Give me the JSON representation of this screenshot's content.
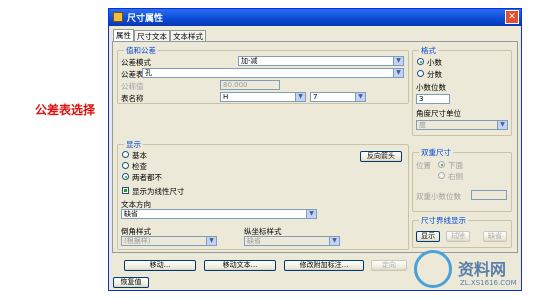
{
  "annotation": {
    "label": "公差表选择"
  },
  "window": {
    "title": "尺寸属性",
    "close_glyph": "✕"
  },
  "tabs": [
    {
      "label": "属性",
      "active": true
    },
    {
      "label": "尺寸文本",
      "active": false
    },
    {
      "label": "文本样式",
      "active": false
    }
  ],
  "value_tolerance": {
    "group_label": "值和公差",
    "tolerance_mode_label": "公差模式",
    "tolerance_mode_value": "加-减",
    "tolerance_table_label": "公差表",
    "tolerance_table_value": "孔",
    "nominal_value_label": "公称值",
    "nominal_value_value": "80.000",
    "table_name_label": "表名称",
    "table_name_value": "H",
    "table_grade_value": "7"
  },
  "format": {
    "group_label": "格式",
    "option_decimal": "小数",
    "option_fraction": "分数",
    "decimal_places_label": "小数位数",
    "decimal_places_value": "3",
    "angle_unit_label": "角度尺寸单位",
    "angle_unit_value": "度"
  },
  "display": {
    "group_label": "显示",
    "option_basic": "基本",
    "option_inspection": "检查",
    "option_neither": "两者都不",
    "flip_arrows_button": "反向箭头",
    "linear_checkbox_label": "显示为线性尺寸",
    "text_direction_label": "文本方向",
    "text_direction_value": "缺省",
    "chamfer_style_label": "倒角样式",
    "chamfer_style_value": "(根据样)",
    "ordinate_style_label": "纵坐标样式",
    "ordinate_style_value": "缺省"
  },
  "dual_dimension": {
    "group_label": "双重尺寸",
    "position_label": "位置",
    "option_below": "下面",
    "option_right": "右侧",
    "decimal_places_label": "双重小数位数"
  },
  "witness_line_display": {
    "group_label": "尺寸界线显示",
    "show_button": "显示",
    "erase_button": "拭除",
    "default_button": "缺省"
  },
  "bottom_buttons": {
    "move": "移动...",
    "move_text": "移动文本...",
    "edit_attachment": "修改附加标注...",
    "locate": "定向"
  },
  "restore_button": "恢复值",
  "watermark": {
    "text": "资料网",
    "url": "ZL.XS1616.COM"
  }
}
